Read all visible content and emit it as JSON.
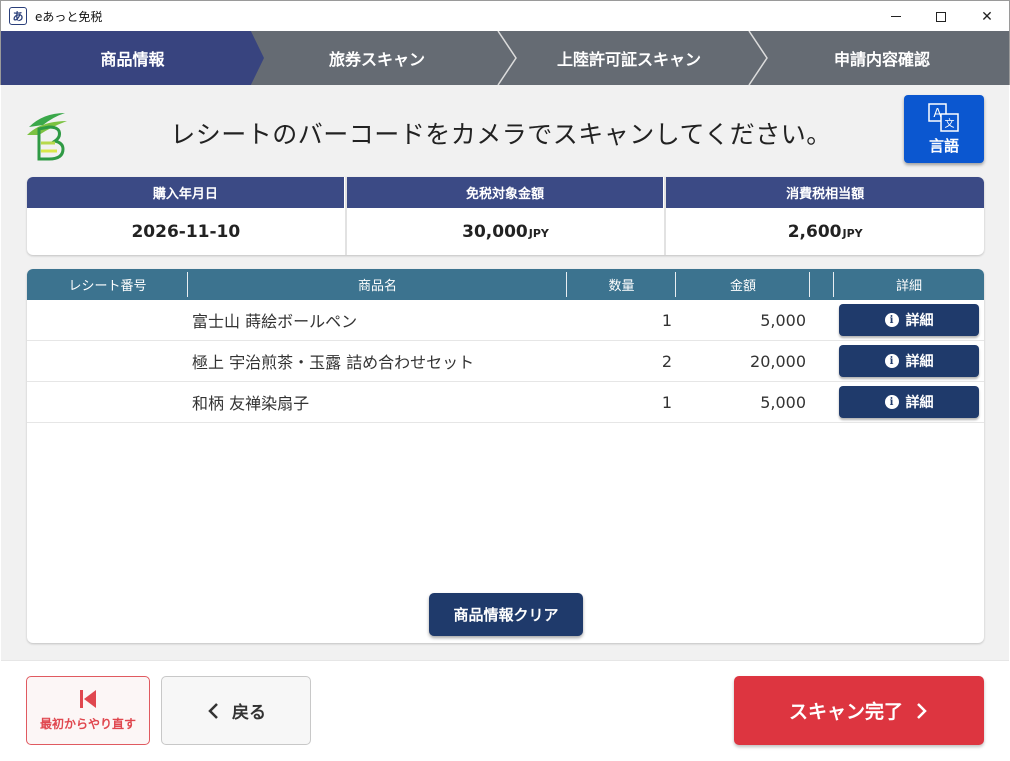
{
  "window": {
    "title": "eあっと免税",
    "icon": "app-logo-icon"
  },
  "steps": [
    {
      "label": "商品情報",
      "active": true
    },
    {
      "label": "旅券スキャン",
      "active": false
    },
    {
      "label": "上陸許可証スキャン",
      "active": false
    },
    {
      "label": "申請内容確認",
      "active": false
    }
  ],
  "header": {
    "instruction": "レシートのバーコードをカメラでスキャンしてください。",
    "language_button": "言語"
  },
  "summary": {
    "purchase_date_label": "購入年月日",
    "purchase_date": "2026-11-10",
    "taxfree_amount_label": "免税対象金額",
    "taxfree_amount": "30,000",
    "tax_label": "消費税相当額",
    "tax_amount": "2,600",
    "currency": "JPY"
  },
  "items_table": {
    "columns": [
      "レシート番号",
      "商品名",
      "数量",
      "金額",
      "",
      "詳細"
    ],
    "rows": [
      {
        "receipt_no": "",
        "name": "富士山 蒔絵ボールペン",
        "qty": "1",
        "amount": "5,000",
        "detail": "詳細"
      },
      {
        "receipt_no": "",
        "name": "極上 宇治煎茶・玉露 詰め合わせセット",
        "qty": "2",
        "amount": "20,000",
        "detail": "詳細"
      },
      {
        "receipt_no": "",
        "name": "和柄 友禅染扇子",
        "qty": "1",
        "amount": "5,000",
        "detail": "詳細"
      }
    ],
    "clear_button": "商品情報クリア"
  },
  "footer": {
    "restart_button": "最初からやり直す",
    "back_button": "戻る",
    "finish_button": "スキャン完了"
  },
  "colors": {
    "step_active": "#38447f",
    "step_inactive": "#656b73",
    "summary_header": "#3b4a85",
    "table_header": "#3c738f",
    "primary_button": "#1f3a6b",
    "language_button": "#0b57d0",
    "finish_button": "#dd3540"
  }
}
